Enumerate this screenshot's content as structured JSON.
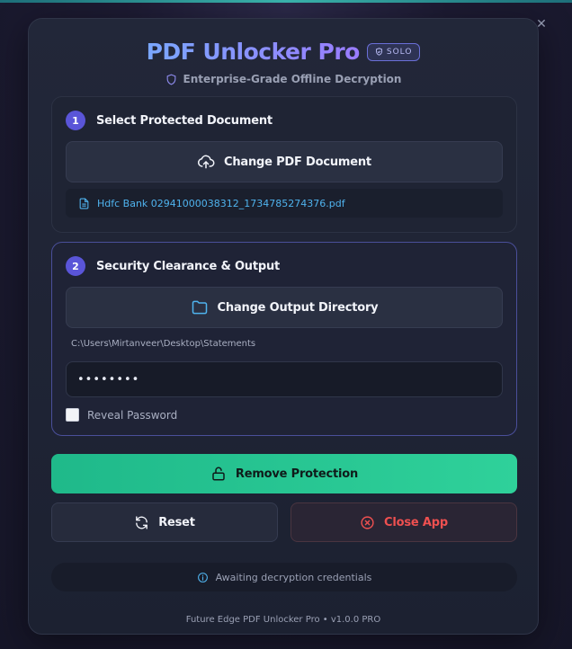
{
  "window": {
    "minimize_glyph": "—",
    "close_glyph": "✕"
  },
  "header": {
    "title": "PDF Unlocker Pro",
    "badge": "SOLO",
    "subtitle": "Enterprise-Grade Offline Decryption"
  },
  "step1": {
    "number": "1",
    "title": "Select Protected Document",
    "button_label": "Change PDF Document",
    "file_name": "Hdfc Bank 02941000038312_1734785274376.pdf"
  },
  "step2": {
    "number": "2",
    "title": "Security Clearance & Output",
    "button_label": "Change Output Directory",
    "output_path": "C:\\Users\\Mirtanveer\\Desktop\\Statements",
    "password_value": "••••••••",
    "reveal_label": "Reveal Password"
  },
  "actions": {
    "primary_label": "Remove Protection",
    "reset_label": "Reset",
    "close_label": "Close App"
  },
  "status": {
    "text": "Awaiting decryption credentials"
  },
  "footer": {
    "text": "Future Edge PDF Unlocker Pro • v1.0.0 PRO"
  },
  "icons": {
    "window_minimize": "minimize-icon",
    "window_close": "close-icon",
    "badge": "shield-icon",
    "subtitle": "shield-icon",
    "step1_button": "cloud-upload-icon",
    "file": "file-icon",
    "step2_button": "folder-icon",
    "primary": "lock-icon",
    "reset": "refresh-icon",
    "close": "x-circle-icon",
    "status": "info-icon"
  },
  "colors": {
    "accent": "#5a55d8",
    "primary_button": "#2fd19a",
    "danger": "#ef5050",
    "file_link": "#4fb3ee"
  }
}
